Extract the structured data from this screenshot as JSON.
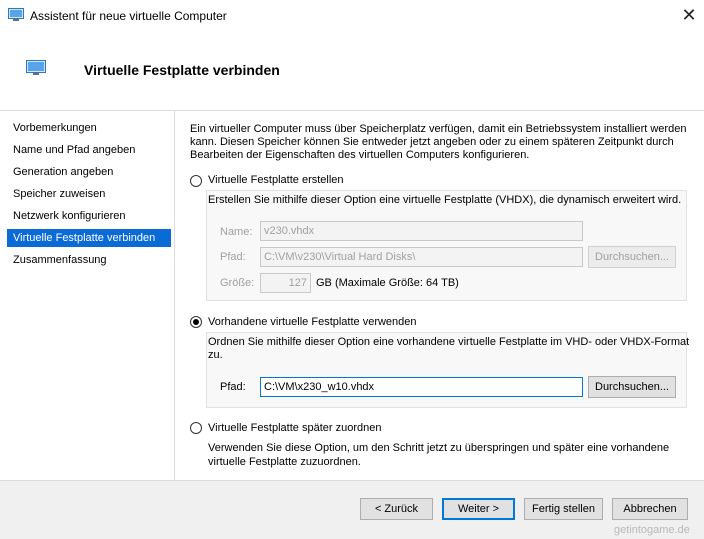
{
  "window": {
    "title": "Assistent für neue virtuelle Computer",
    "close_icon": "close-icon"
  },
  "header": {
    "title": "Virtuelle Festplatte verbinden",
    "icon": "virtual-machine-icon"
  },
  "nav": {
    "items": [
      {
        "label": "Vorbemerkungen"
      },
      {
        "label": "Name und Pfad angeben"
      },
      {
        "label": "Generation angeben"
      },
      {
        "label": "Speicher zuweisen"
      },
      {
        "label": "Netzwerk konfigurieren"
      },
      {
        "label": "Virtuelle Festplatte verbinden"
      },
      {
        "label": "Zusammenfassung"
      }
    ],
    "selected_index": 5
  },
  "content": {
    "intro_line1": "Ein virtueller Computer muss über Speicherplatz verfügen, damit ein Betriebssystem installiert werden",
    "intro_line2": "kann. Diesen Speicher können Sie entweder jetzt angeben oder zu einem späteren Zeitpunkt durch",
    "intro_line3": "Bearbeiten der Eigenschaften des virtuellen Computers konfigurieren.",
    "option_create": {
      "label": "Virtuelle Festplatte erstellen",
      "description": "Erstellen Sie mithilfe dieser Option eine virtuelle Festplatte (VHDX), die dynamisch erweitert wird.",
      "name_label": "Name:",
      "name_value": "v230.vhdx",
      "path_label": "Pfad:",
      "path_value": "C:\\VM\\v230\\Virtual Hard Disks\\",
      "browse_label": "Durchsuchen...",
      "size_label": "Größe:",
      "size_value": "127",
      "size_unit": "GB (Maximale Größe: 64 TB)"
    },
    "option_existing": {
      "label": "Vorhandene virtuelle Festplatte verwenden",
      "description_line1": "Ordnen Sie mithilfe dieser Option eine vorhandene virtuelle Festplatte im VHD- oder VHDX-Format",
      "description_line2": "zu.",
      "path_label": "Pfad:",
      "path_value": "C:\\VM\\x230_w10.vhdx",
      "browse_label": "Durchsuchen..."
    },
    "option_later": {
      "label": "Virtuelle Festplatte später zuordnen",
      "description_line1": "Verwenden Sie diese Option, um den Schritt jetzt zu überspringen und später eine vorhandene",
      "description_line2": "virtuelle Festplatte zuzuordnen."
    },
    "selected_option": "existing"
  },
  "footer": {
    "back_label": "< Zurück",
    "next_label": "Weiter >",
    "finish_label": "Fertig stellen",
    "cancel_label": "Abbrechen"
  },
  "watermark": "getintogame.de",
  "colors": {
    "selection": "#0a6ad6",
    "focus_border": "#0078d7"
  }
}
